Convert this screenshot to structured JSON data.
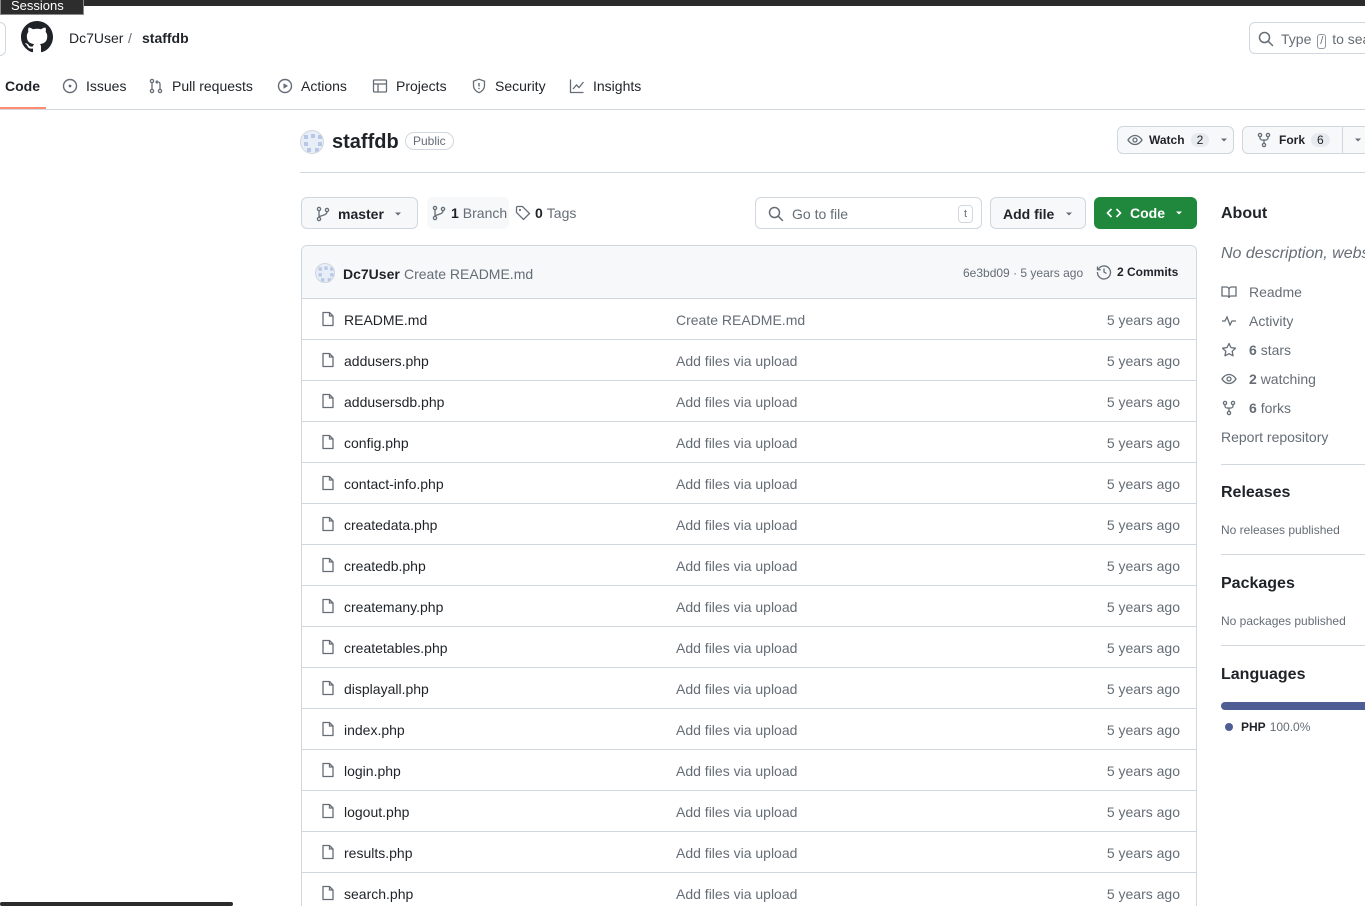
{
  "tooltip": "Sessions",
  "header": {
    "owner": "Dc7User",
    "separator": "/",
    "repo": "staffdb",
    "search_prefix": "Type",
    "search_key": "/",
    "search_suffix": "to sea"
  },
  "tabs": [
    {
      "label": "Code",
      "icon": "code-icon"
    },
    {
      "label": "Issues",
      "icon": "issue-icon"
    },
    {
      "label": "Pull requests",
      "icon": "pull-request-icon"
    },
    {
      "label": "Actions",
      "icon": "play-icon"
    },
    {
      "label": "Projects",
      "icon": "table-icon"
    },
    {
      "label": "Security",
      "icon": "shield-icon"
    },
    {
      "label": "Insights",
      "icon": "graph-icon"
    }
  ],
  "repo_head": {
    "name": "staffdb",
    "visibility": "Public",
    "watch_label": "Watch",
    "watch_count": "2",
    "fork_label": "Fork",
    "fork_count": "6"
  },
  "toolbar": {
    "branch": "master",
    "branches_count": "1",
    "branches_label": "Branch",
    "tags_count": "0",
    "tags_label": "Tags",
    "goto_placeholder": "Go to file",
    "goto_key": "t",
    "add_file": "Add file",
    "code": "Code"
  },
  "commit": {
    "author": "Dc7User",
    "message": "Create README.md",
    "sha": "6e3bd09",
    "dot": "·",
    "age": "5 years ago",
    "commits_label": "2 Commits"
  },
  "files": [
    {
      "name": "README.md",
      "message": "Create README.md",
      "age": "5 years ago"
    },
    {
      "name": "addusers.php",
      "message": "Add files via upload",
      "age": "5 years ago"
    },
    {
      "name": "addusersdb.php",
      "message": "Add files via upload",
      "age": "5 years ago"
    },
    {
      "name": "config.php",
      "message": "Add files via upload",
      "age": "5 years ago"
    },
    {
      "name": "contact-info.php",
      "message": "Add files via upload",
      "age": "5 years ago"
    },
    {
      "name": "createdata.php",
      "message": "Add files via upload",
      "age": "5 years ago"
    },
    {
      "name": "createdb.php",
      "message": "Add files via upload",
      "age": "5 years ago"
    },
    {
      "name": "createmany.php",
      "message": "Add files via upload",
      "age": "5 years ago"
    },
    {
      "name": "createtables.php",
      "message": "Add files via upload",
      "age": "5 years ago"
    },
    {
      "name": "displayall.php",
      "message": "Add files via upload",
      "age": "5 years ago"
    },
    {
      "name": "index.php",
      "message": "Add files via upload",
      "age": "5 years ago"
    },
    {
      "name": "login.php",
      "message": "Add files via upload",
      "age": "5 years ago"
    },
    {
      "name": "logout.php",
      "message": "Add files via upload",
      "age": "5 years ago"
    },
    {
      "name": "results.php",
      "message": "Add files via upload",
      "age": "5 years ago"
    },
    {
      "name": "search.php",
      "message": "Add files via upload",
      "age": "5 years ago"
    }
  ],
  "sidebar": {
    "about_title": "About",
    "description": "No description, websi",
    "readme": "Readme",
    "activity": "Activity",
    "stars_count": "6",
    "stars_label": "stars",
    "watching_count": "2",
    "watching_label": "watching",
    "forks_count": "6",
    "forks_label": "forks",
    "report": "Report repository",
    "releases_title": "Releases",
    "releases_text": "No releases published",
    "packages_title": "Packages",
    "packages_text": "No packages published",
    "languages_title": "Languages",
    "language_name": "PHP",
    "language_percent": "100.0%",
    "language_color": "#4f5d95"
  },
  "colors": {
    "accent_green": "#1f883d",
    "tab_underline": "#fd8c73",
    "border": "#d0d7de",
    "muted": "#656d76"
  }
}
